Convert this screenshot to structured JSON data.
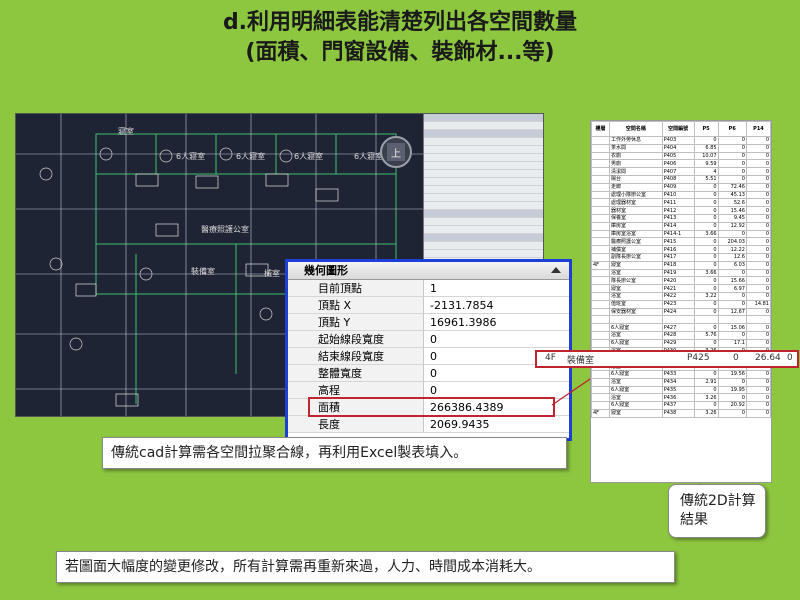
{
  "title": {
    "line1": "d.利用明細表能清楚列出各空間數量",
    "line2": "(面積、門窗設備、裝飾材...等)"
  },
  "cad": {
    "room_labels": [
      "寢室",
      "6人寢室",
      "6人寢室",
      "6人寢室",
      "6人寢室",
      "醫療照護公室",
      "裝備室",
      "械室"
    ],
    "compass": "上"
  },
  "properties_panel": {
    "header": "幾何圖形",
    "rows": [
      {
        "key": "目前頂點",
        "value": "1"
      },
      {
        "key": "頂點 X",
        "value": "-2131.7854"
      },
      {
        "key": "頂點 Y",
        "value": "16961.3986"
      },
      {
        "key": "起始線段寬度",
        "value": "0"
      },
      {
        "key": "結束線段寬度",
        "value": "0"
      },
      {
        "key": "整體寬度",
        "value": "0"
      },
      {
        "key": "高程",
        "value": "0"
      },
      {
        "key": "面積",
        "value": "266386.4389"
      },
      {
        "key": "長度",
        "value": "2069.9435"
      }
    ]
  },
  "spreadsheet": {
    "headers": [
      "樓層",
      "空間名稱",
      "空間編號",
      "P5",
      "P6",
      "P14"
    ],
    "rows": [
      [
        "",
        "工作外勞休息",
        "P403",
        "0",
        "0",
        "0"
      ],
      [
        "",
        "茶水間",
        "P404",
        "6.85",
        "0",
        "0"
      ],
      [
        "",
        "衣廁",
        "P405",
        "10.07",
        "0",
        "0"
      ],
      [
        "",
        "男廁",
        "P406",
        "9.59",
        "0",
        "0"
      ],
      [
        "",
        "清潔間",
        "P407",
        "4",
        "0",
        "0"
      ],
      [
        "",
        "陽台",
        "P408",
        "5.51",
        "0",
        "0"
      ],
      [
        "",
        "走廊",
        "P409",
        "0",
        "72.46",
        "0"
      ],
      [
        "",
        "處理小隊辦公室",
        "P410",
        "0",
        "45.13",
        "0"
      ],
      [
        "",
        "處理器材室",
        "P411",
        "0",
        "52.6",
        "0"
      ],
      [
        "",
        "器材室",
        "P412",
        "0",
        "15.46",
        "0"
      ],
      [
        "",
        "保養室",
        "P413",
        "0",
        "9.45",
        "0"
      ],
      [
        "",
        "庫房室",
        "P414",
        "0",
        "12.92",
        "0"
      ],
      [
        "",
        "庫房室浴室",
        "P414-1",
        "3.66",
        "0",
        "0"
      ],
      [
        "",
        "醫療照護公室",
        "P415",
        "0",
        "204.03",
        "0"
      ],
      [
        "",
        "補償室",
        "P416",
        "0",
        "12.22",
        "0"
      ],
      [
        "",
        "副隊長辦公室",
        "P417",
        "0",
        "12.6",
        "0"
      ],
      [
        "4F",
        "寢室",
        "P418",
        "0",
        "6.03",
        "0"
      ],
      [
        "",
        "浴室",
        "P419",
        "3.66",
        "0",
        "0"
      ],
      [
        "",
        "隊長辦公室",
        "P420",
        "0",
        "15.66",
        "0"
      ],
      [
        "",
        "寢室",
        "P421",
        "0",
        "6.97",
        "0"
      ],
      [
        "",
        "浴室",
        "P422",
        "3.22",
        "0",
        "0"
      ],
      [
        "",
        "值班室",
        "P423",
        "0",
        "0",
        "14.81"
      ],
      [
        "",
        "保安器材室",
        "P424",
        "0",
        "12.67",
        "0"
      ],
      [
        "",
        "",
        "",
        "",
        "",
        ""
      ],
      [
        "",
        "6人寢室",
        "P427",
        "0",
        "15.06",
        "0"
      ],
      [
        "",
        "浴室",
        "P428",
        "5.76",
        "0",
        "0"
      ],
      [
        "",
        "6人寢室",
        "P429",
        "0",
        "17.1",
        "0"
      ],
      [
        "",
        "浴室",
        "P430",
        "3.26",
        "0",
        "0"
      ],
      [
        "",
        "6人寢室",
        "P431",
        "0",
        "17.1",
        "0"
      ],
      [
        "",
        "浴室",
        "P432",
        "3.26",
        "0",
        "0"
      ],
      [
        "",
        "6人寢室",
        "P433",
        "0",
        "19.56",
        "0"
      ],
      [
        "",
        "浴室",
        "P434",
        "2.91",
        "0",
        "0"
      ],
      [
        "",
        "6人寢室",
        "P435",
        "0",
        "19.95",
        "0"
      ],
      [
        "",
        "浴室",
        "P436",
        "3.26",
        "0",
        "0"
      ],
      [
        "",
        "6人寢室",
        "P437",
        "0",
        "20.92",
        "0"
      ],
      [
        "4F",
        "寢室",
        "P438",
        "3.26",
        "0",
        "0"
      ]
    ],
    "highlight": {
      "floor": "4F",
      "name": "裝備室",
      "code": "P425",
      "p5": "0",
      "p6": "26.64",
      "p14": "0"
    }
  },
  "notes": {
    "note1": "傳統cad計算需各空間拉聚合線，再利用Excel製表填入。",
    "note2_line1": "傳統2D計算",
    "note2_line2": "結果",
    "note3": "若圖面大幅度的變更修改，所有計算需再重新來過，人力、時間成本消耗大。"
  }
}
